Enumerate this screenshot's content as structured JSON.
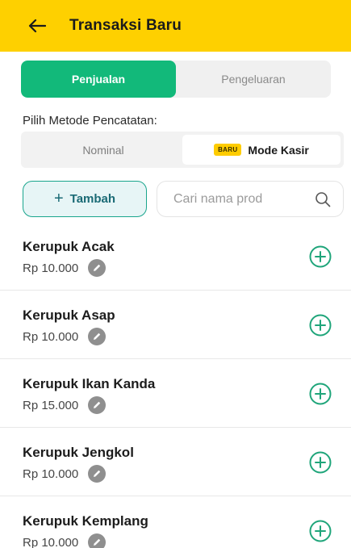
{
  "appbar": {
    "title": "Transaksi Baru",
    "back_icon": "arrow-left-icon",
    "background": "#fed000"
  },
  "tabs": [
    {
      "label": "Penjualan",
      "active": true
    },
    {
      "label": "Pengeluaran",
      "active": false
    }
  ],
  "method": {
    "label": "Pilih Metode Pencatatan:",
    "options": [
      {
        "label": "Nominal",
        "active": false
      },
      {
        "label": "Mode Kasir",
        "badge": "BARU",
        "active": true
      }
    ]
  },
  "actions": {
    "add_label": "Tambah",
    "add_icon": "plus-icon",
    "search_placeholder": "Cari nama prod",
    "search_icon": "search-icon"
  },
  "products": [
    {
      "name": "Kerupuk Acak",
      "price": "Rp 10.000"
    },
    {
      "name": "Kerupuk Asap",
      "price": "Rp 10.000"
    },
    {
      "name": "Kerupuk Ikan Kanda",
      "price": "Rp 15.000"
    },
    {
      "name": "Kerupuk Jengkol",
      "price": "Rp 10.000"
    },
    {
      "name": "Kerupuk Kemplang",
      "price": "Rp 10.000"
    }
  ],
  "colors": {
    "accent_green": "#12b97a",
    "add_icon_green": "#1fa57a",
    "badge_yellow": "#fecc00"
  }
}
